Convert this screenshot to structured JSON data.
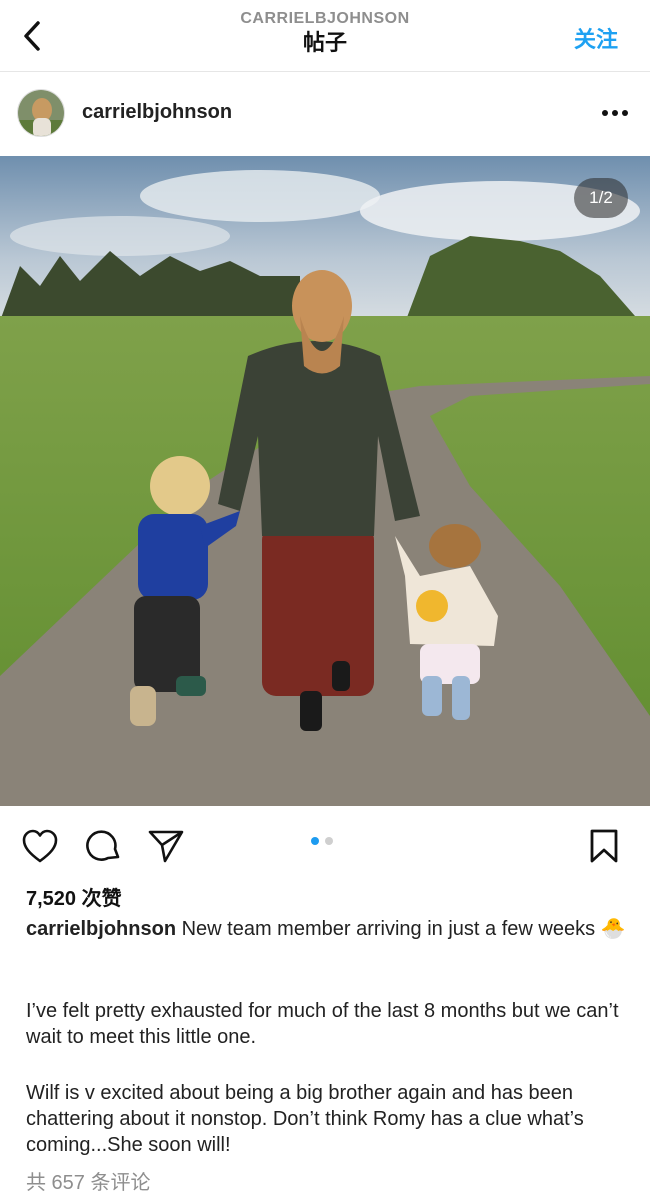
{
  "header": {
    "username": "CARRIELBJOHNSON",
    "title": "帖子",
    "follow_label": "关注"
  },
  "post": {
    "author": "carrielbjohnson",
    "image_counter": "1/2",
    "image_count": 2,
    "current_image_index": 1,
    "likes": "7,520 次赞",
    "caption_user": "carrielbjohnson",
    "caption_text": "New team member arriving in just a few weeks",
    "caption_emoji": "🐣",
    "paragraph_1": "I’ve felt pretty exhausted for much of the last 8 months but we can’t wait to meet this little one.",
    "paragraph_2": "Wilf is v excited about being a big brother again and has been chattering about it nonstop. Don’t think Romy has a clue what’s coming...She soon will!",
    "comments_link": "共 657 条评论"
  },
  "icons": {
    "back": "chevron-left-icon",
    "more": "more-horizontal-icon",
    "like": "heart-icon",
    "comment": "comment-icon",
    "share": "send-icon",
    "save": "bookmark-icon"
  },
  "colors": {
    "accent": "#1da1f2",
    "active_dot": "#1d9bf0",
    "muted_text": "#8e8e8e"
  }
}
